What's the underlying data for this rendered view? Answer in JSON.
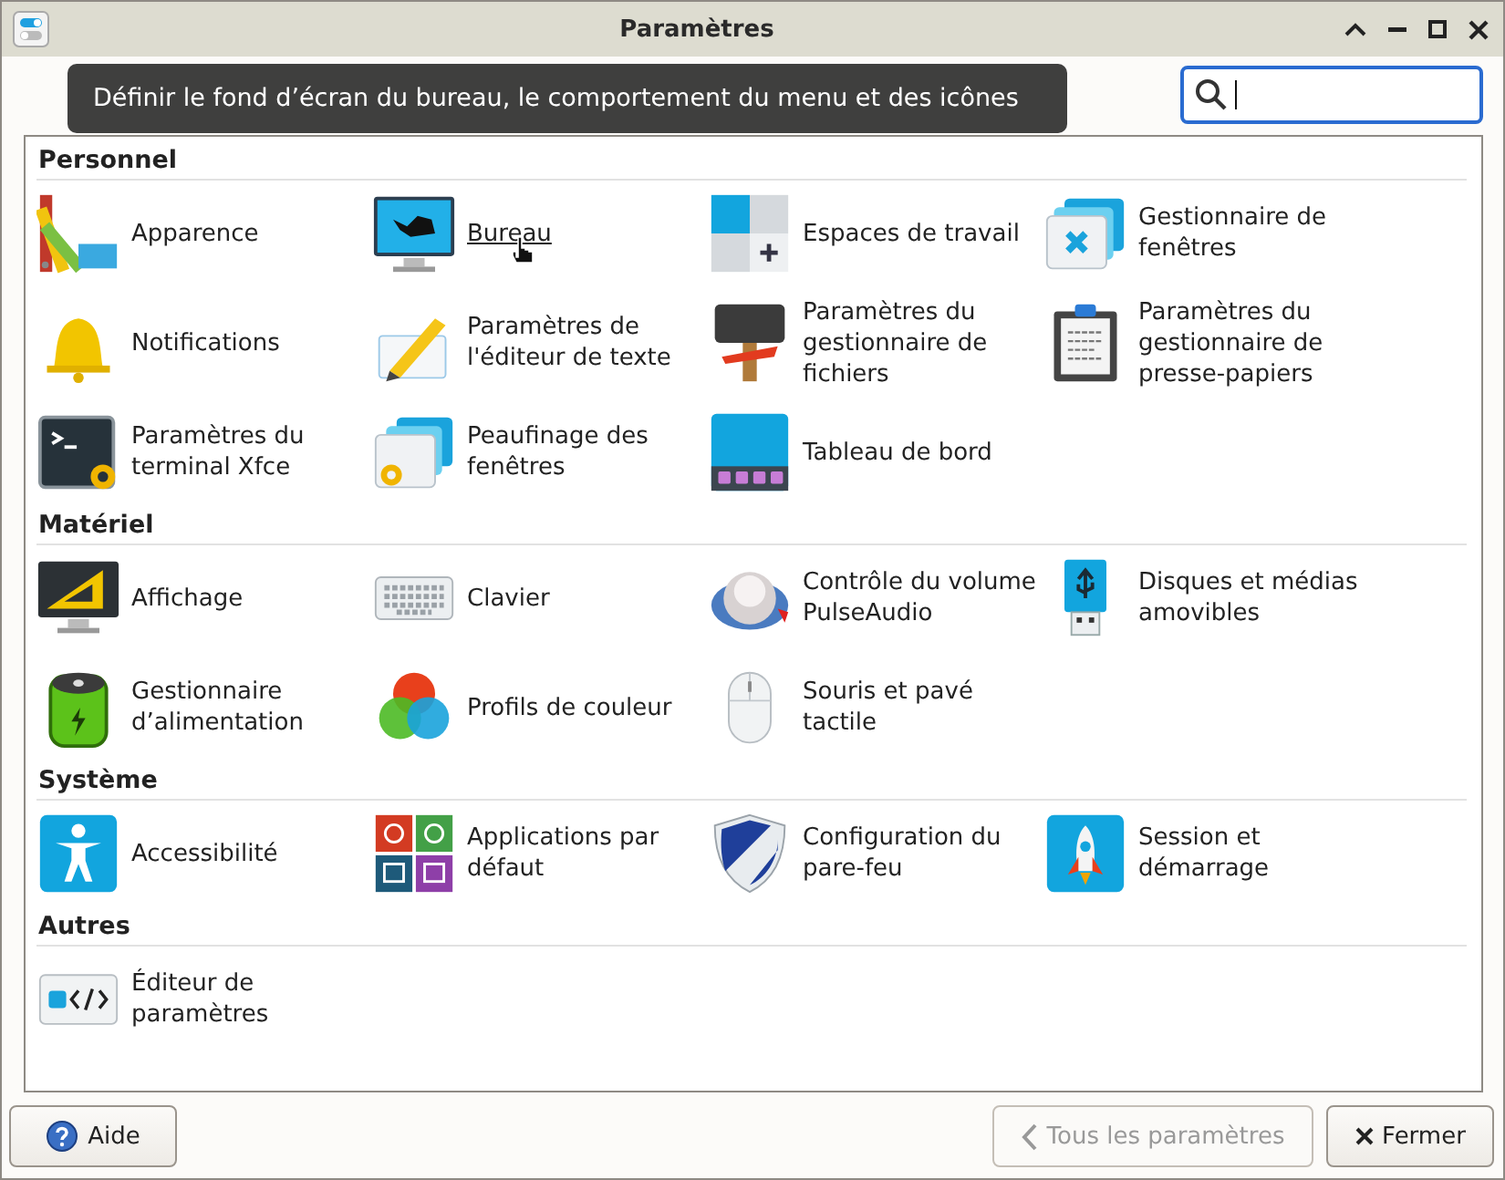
{
  "window": {
    "title": "Paramètres"
  },
  "search": {
    "focused": true
  },
  "sections": [
    {
      "title": "Personnel",
      "items": [
        {
          "label": "Apparence",
          "hovered": false
        },
        {
          "label": "Bureau",
          "hovered": true
        },
        {
          "label": "Espaces de travail",
          "hovered": false
        },
        {
          "label": "Gestionnaire de fenêtres",
          "hovered": false
        },
        {
          "label": "Notifications",
          "hovered": false
        },
        {
          "label": "Paramètres de l'éditeur de texte",
          "hovered": false
        },
        {
          "label": "Paramètres du gestionnaire de fichiers",
          "hovered": false
        },
        {
          "label": "Paramètres du gestionnaire de presse-papiers",
          "hovered": false
        },
        {
          "label": "Paramètres du terminal Xfce",
          "hovered": false
        },
        {
          "label": "Peaufinage des fenêtres",
          "hovered": false
        },
        {
          "label": "Tableau de bord",
          "hovered": false
        }
      ]
    },
    {
      "title": "Matériel",
      "items": [
        {
          "label": "Affichage",
          "hovered": false
        },
        {
          "label": "Clavier",
          "hovered": false
        },
        {
          "label": "Contrôle du volume PulseAudio",
          "hovered": false
        },
        {
          "label": "Disques et médias amovibles",
          "hovered": false
        },
        {
          "label": "Gestionnaire d’alimentation",
          "hovered": false
        },
        {
          "label": "Profils de couleur",
          "hovered": false
        },
        {
          "label": "Souris et pavé tactile",
          "hovered": false
        }
      ]
    },
    {
      "title": "Système",
      "items": [
        {
          "label": "Accessibilité",
          "hovered": false
        },
        {
          "label": "Applications par défaut",
          "hovered": false
        },
        {
          "label": "Configuration du pare-feu",
          "hovered": false
        },
        {
          "label": "Session et démarrage",
          "hovered": false
        }
      ]
    },
    {
      "title": "Autres",
      "items": [
        {
          "label": "Éditeur de paramètres",
          "hovered": false
        }
      ]
    }
  ],
  "tooltip": {
    "text": "Définir le fond d’écran du bureau, le comportement du menu et des icônes"
  },
  "buttons": [
    {
      "label": "Aide",
      "kind": "help",
      "disabled": false
    },
    {
      "label": "Tous les paramètres",
      "kind": "back",
      "disabled": true
    },
    {
      "label": "Fermer",
      "kind": "close",
      "disabled": false
    }
  ]
}
